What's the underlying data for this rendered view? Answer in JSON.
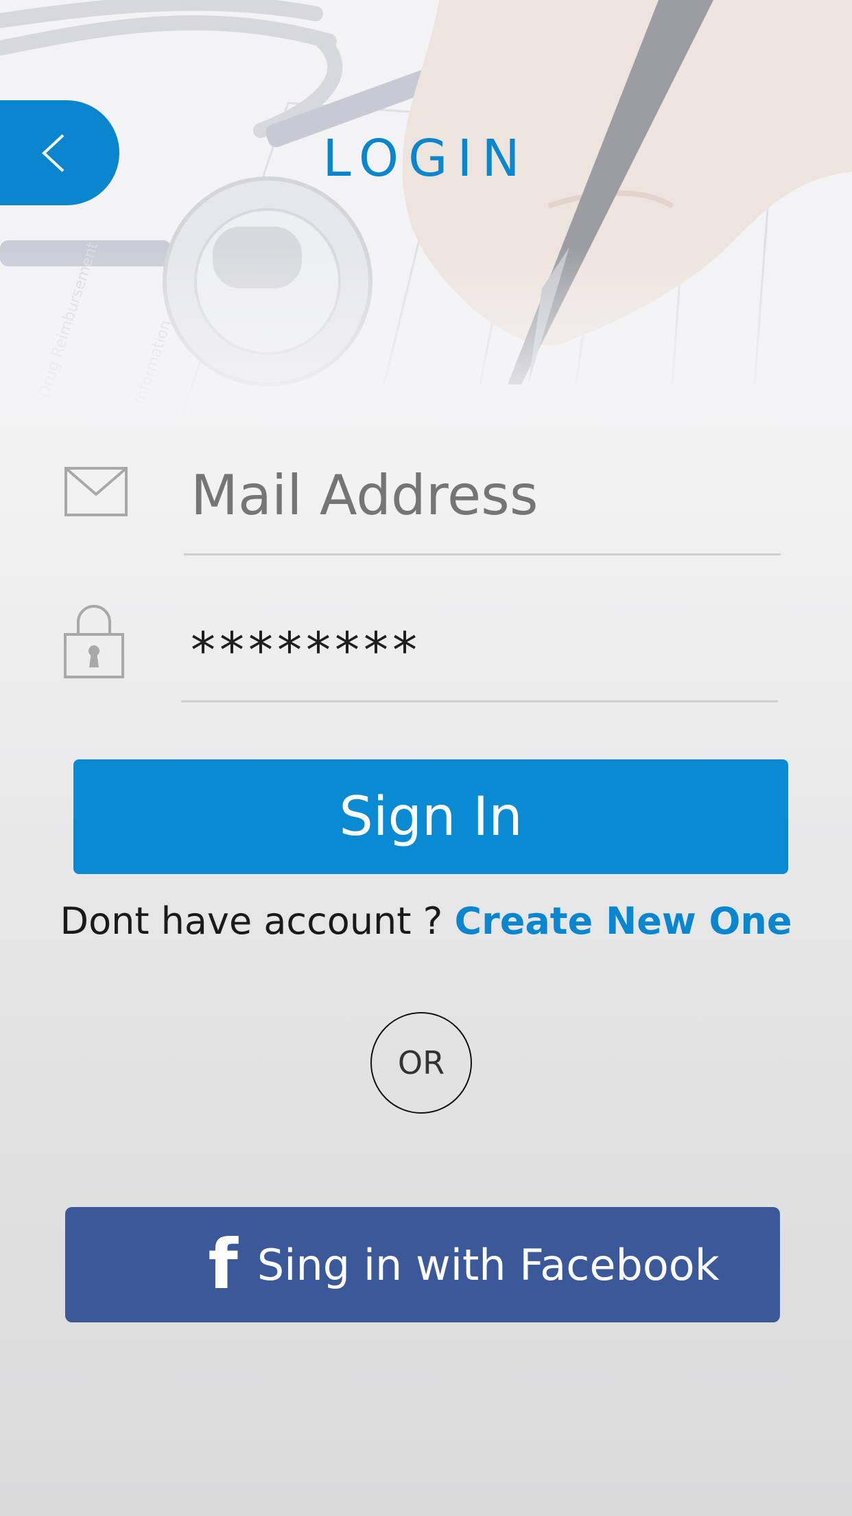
{
  "header": {
    "back_icon": "chevron-left-icon",
    "title": "LOGIN"
  },
  "form": {
    "email": {
      "icon": "mail-icon",
      "placeholder": "Mail Address",
      "value": ""
    },
    "password": {
      "icon": "lock-icon",
      "placeholder": "",
      "value": "********"
    },
    "sign_in_label": "Sign In"
  },
  "account": {
    "prompt": "Dont have account ? ",
    "create_link": "Create New One"
  },
  "divider": {
    "label": "OR"
  },
  "facebook": {
    "icon": "facebook-icon",
    "label": "Sing in with Facebook"
  },
  "colors": {
    "accent": "#0a86cf",
    "facebook": "#3b5998",
    "text": "#1f1f1f"
  }
}
